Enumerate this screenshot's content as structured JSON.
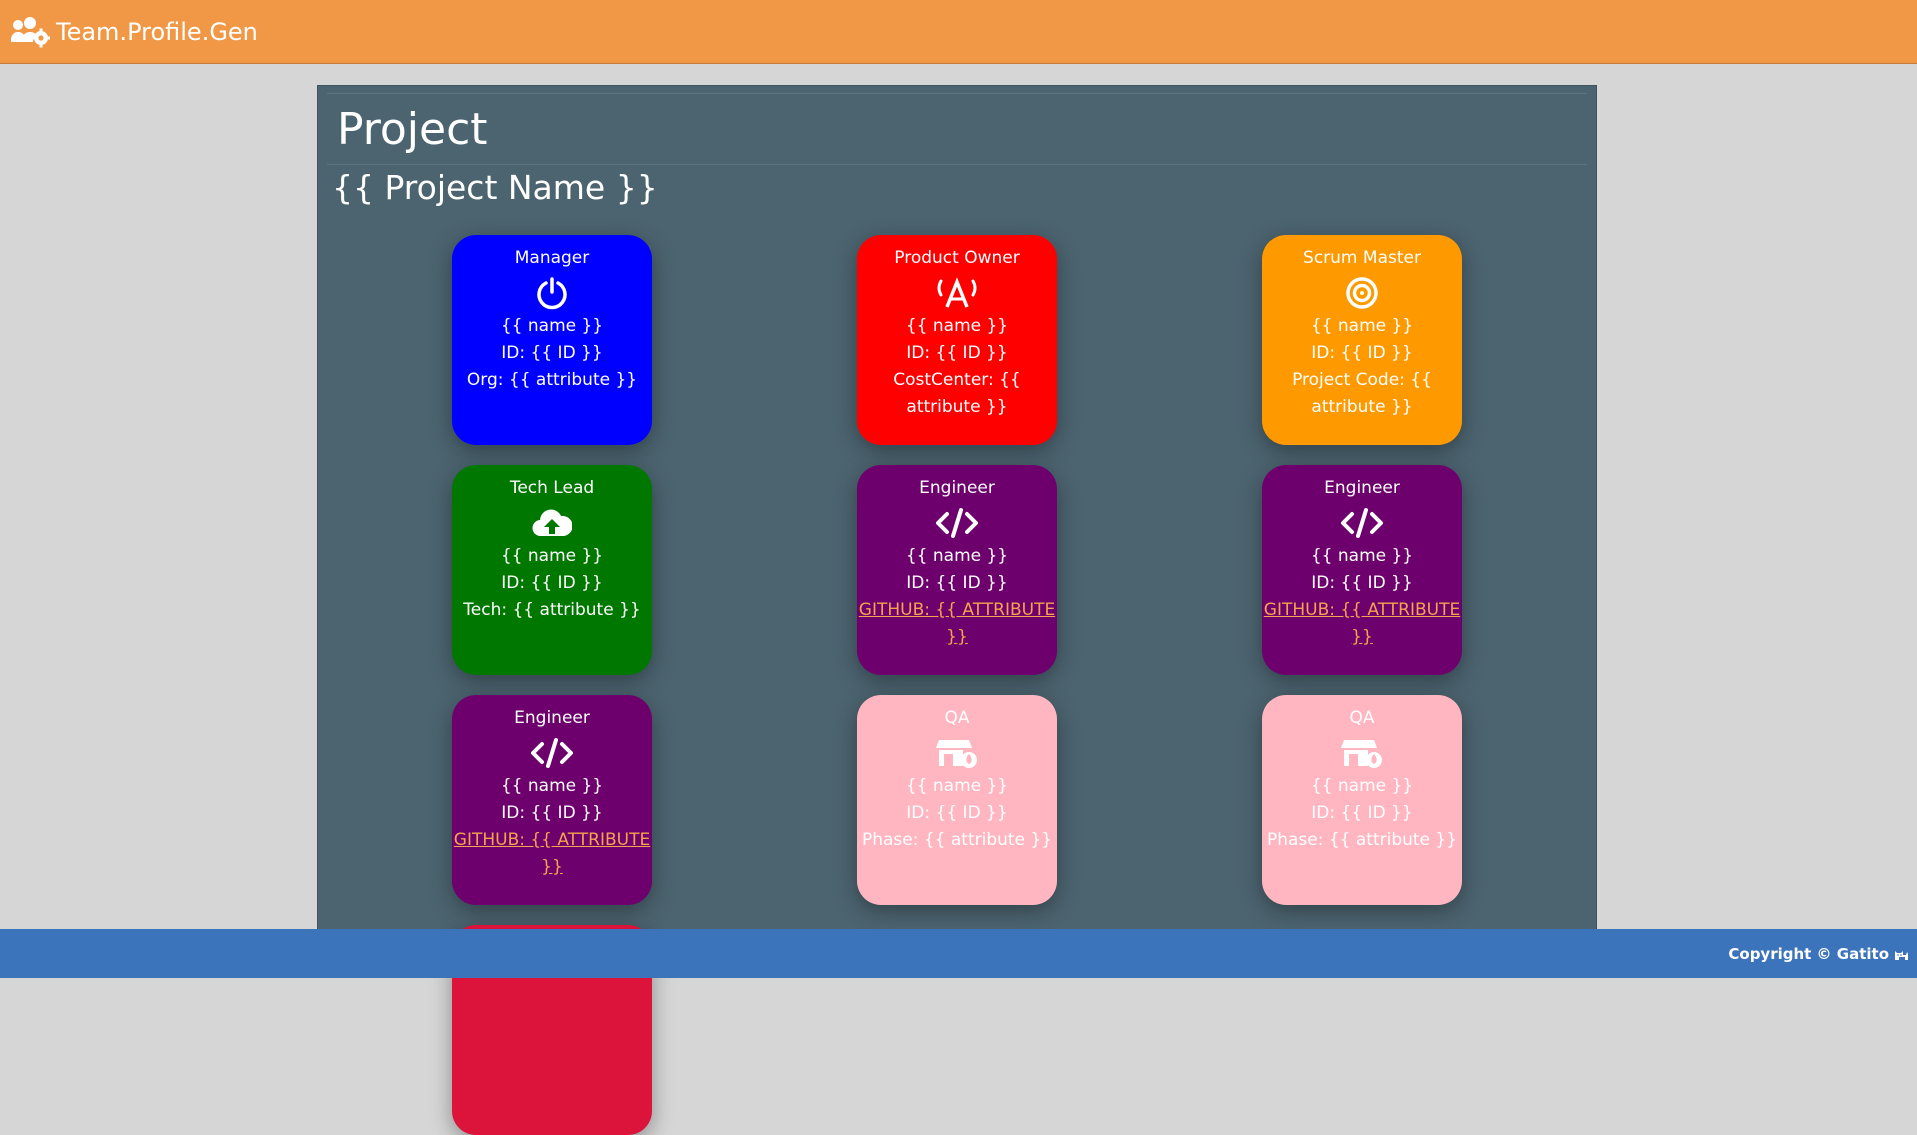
{
  "navbar": {
    "brand": "Team.Profile.Gen",
    "brand_icon": "users-cog-icon"
  },
  "header": {
    "title": "Project",
    "project_name": "{{ Project Name }}"
  },
  "cards": [
    {
      "role": "Manager",
      "icon": "power-icon",
      "color": "#0000ff",
      "name": "{{ name }}",
      "id": "ID: {{ ID }}",
      "attr": "Org: {{ attribute }}",
      "attr_is_link": false
    },
    {
      "role": "Product Owner",
      "icon": "antenna-icon",
      "color": "#ff0000",
      "name": "{{ name }}",
      "id": "ID: {{ ID }}",
      "attr": "CostCenter: {{ attribute }}",
      "attr_is_link": false
    },
    {
      "role": "Scrum Master",
      "icon": "bullseye-icon",
      "color": "#ff9900",
      "name": "{{ name }}",
      "id": "ID: {{ ID }}",
      "attr": "Project Code: {{ attribute }}",
      "attr_is_link": false
    },
    {
      "role": "Tech Lead",
      "icon": "cloud-upload-icon",
      "color": "#007800",
      "name": "{{ name }}",
      "id": "ID: {{ ID }}",
      "attr": "Tech: {{ attribute }}",
      "attr_is_link": false
    },
    {
      "role": "Engineer",
      "icon": "code-icon",
      "color": "#6d006d",
      "name": "{{ name }}",
      "id": "ID: {{ ID }}",
      "attr": "GITHUB: {{ ATTRIBUTE }}",
      "attr_is_link": true
    },
    {
      "role": "Engineer",
      "icon": "code-icon",
      "color": "#6d006d",
      "name": "{{ name }}",
      "id": "ID: {{ ID }}",
      "attr": "GITHUB: {{ ATTRIBUTE }}",
      "attr_is_link": true
    },
    {
      "role": "Engineer",
      "icon": "code-icon",
      "color": "#6d006d",
      "name": "{{ name }}",
      "id": "ID: {{ ID }}",
      "attr": "GITHUB: {{ ATTRIBUTE }}",
      "attr_is_link": true
    },
    {
      "role": "QA",
      "icon": "store-fire-icon",
      "color": "#ffb6c1",
      "name": "{{ name }}",
      "id": "ID: {{ ID }}",
      "attr": "Phase: {{ attribute }}",
      "attr_is_link": false
    },
    {
      "role": "QA",
      "icon": "store-fire-icon",
      "color": "#ffb6c1",
      "name": "{{ name }}",
      "id": "ID: {{ ID }}",
      "attr": "Phase: {{ attribute }}",
      "attr_is_link": false
    }
  ],
  "footer": {
    "copyright": "Copyright © Gatito",
    "icon": "cat-icon"
  }
}
